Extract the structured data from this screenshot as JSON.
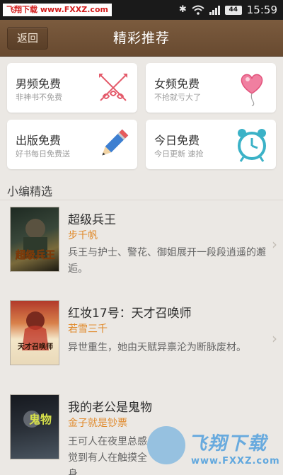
{
  "status_bar": {
    "watermark": "飞翔下载 www.FXXZ.com",
    "battery": "44",
    "time": "15:59",
    "icons": [
      "bluetooth-icon",
      "wifi-icon",
      "signal-icon",
      "battery-icon"
    ]
  },
  "header": {
    "back_label": "返回",
    "title": "精彩推荐"
  },
  "categories": [
    {
      "title": "男频免费",
      "subtitle": "非神书不免费",
      "icon": "crossed-arrows-icon"
    },
    {
      "title": "女频免费",
      "subtitle": "不抢就亏大了",
      "icon": "heart-balloon-icon"
    },
    {
      "title": "出版免费",
      "subtitle": "好书每日免费送",
      "icon": "pencil-icon"
    },
    {
      "title": "今日免费",
      "subtitle": "今日更新 速抢",
      "icon": "alarm-clock-icon"
    }
  ],
  "section": {
    "title": "小编精选"
  },
  "books": [
    {
      "title": "超级兵王",
      "author": "步千帆",
      "description": "兵王与护士、警花、御姐展开一段段逍遥的邂逅。",
      "cover_text": "超级兵王"
    },
    {
      "title": "红妆17号：天才召唤师",
      "author": "若雪三千",
      "description": "异世重生，她由天赋异禀沦为断脉废材。",
      "cover_text": "天才召唤师"
    },
    {
      "title": "我的老公是鬼物",
      "author": "金子就是钞票",
      "description": "王可人在夜里总感觉到有人在触摸全身",
      "cover_text": "鬼物"
    }
  ],
  "watermark_bottom": {
    "text": "飞翔下载",
    "url": "www.FXXZ.com"
  },
  "colors": {
    "header": "#6f5034",
    "author": "#e08a2c",
    "background": "#ebe8e4"
  }
}
